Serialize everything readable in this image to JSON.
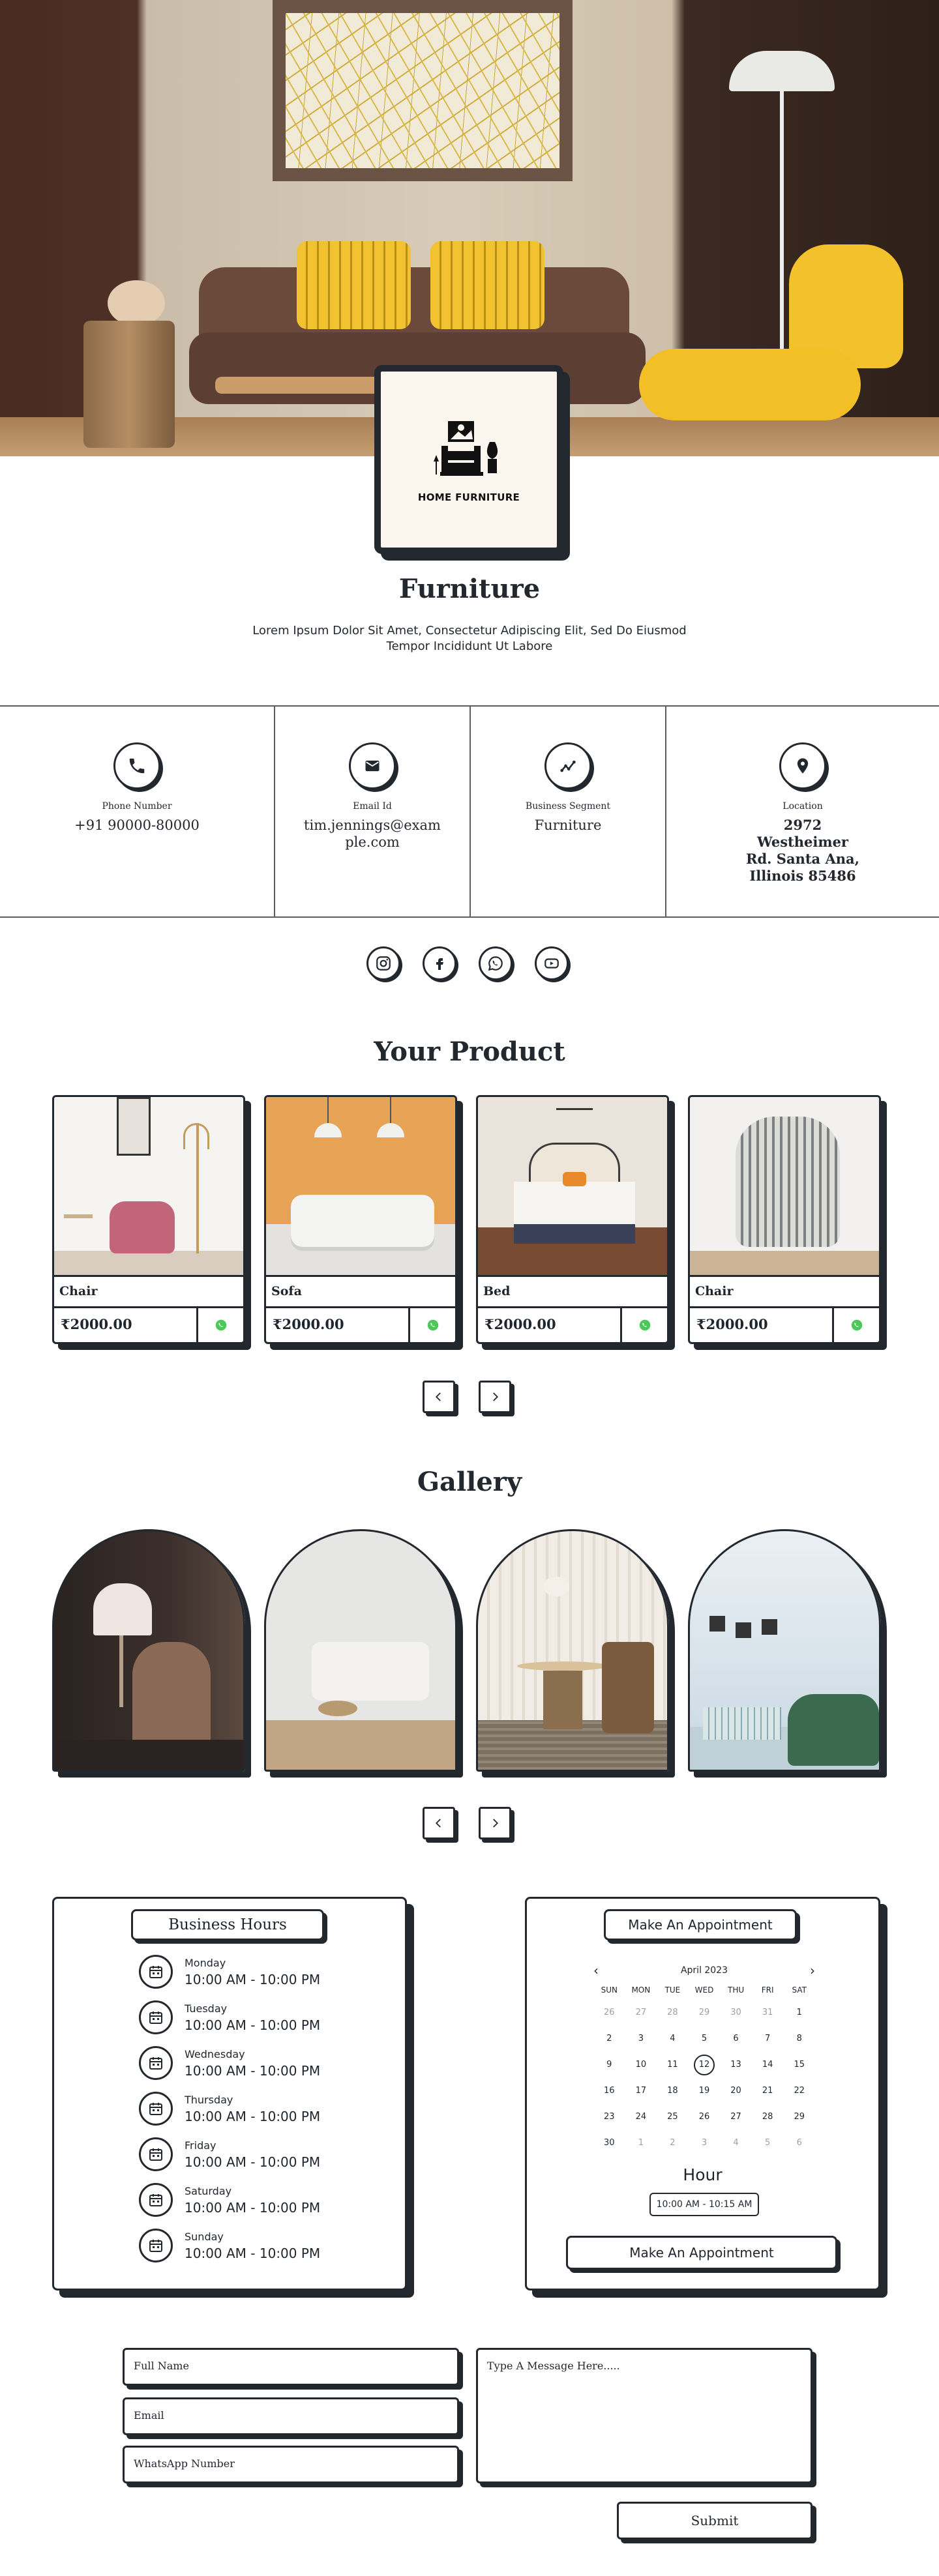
{
  "header": {
    "logo_text": "HOME FURNITURE",
    "business_name": "Furniture",
    "tagline": "Lorem Ipsum Dolor Sit Amet, Consectetur Adipiscing Elit, Sed Do Eiusmod Tempor Incididunt Ut Labore"
  },
  "contacts": [
    {
      "label": "Phone Number",
      "value": "+91 90000-80000",
      "icon": "phone-icon"
    },
    {
      "label": "Email Id",
      "value": "tim.jennings@example.com",
      "icon": "email-icon"
    },
    {
      "label": "Business Segment",
      "value": "Furniture",
      "icon": "segment-icon"
    },
    {
      "label": "Location",
      "value": "2972 Westheimer Rd. Santa Ana, Illinois 85486",
      "icon": "location-icon"
    }
  ],
  "socials": [
    "instagram-icon",
    "facebook-icon",
    "whatsapp-icon",
    "youtube-icon"
  ],
  "products": {
    "title": "Your Product",
    "items": [
      {
        "name": "Chair",
        "price": "₹2000.00"
      },
      {
        "name": "Sofa",
        "price": "₹2000.00"
      },
      {
        "name": "Bed",
        "price": "₹2000.00"
      },
      {
        "name": "Chair",
        "price": "₹2000.00"
      }
    ]
  },
  "gallery": {
    "title": "Gallery"
  },
  "hours": {
    "title": "Business Hours",
    "days": [
      {
        "day": "Monday",
        "time": "10:00 AM - 10:00 PM"
      },
      {
        "day": "Tuesday",
        "time": "10:00 AM - 10:00 PM"
      },
      {
        "day": "Wednesday",
        "time": "10:00 AM - 10:00 PM"
      },
      {
        "day": "Thursday",
        "time": "10:00 AM - 10:00 PM"
      },
      {
        "day": "Friday",
        "time": "10:00 AM - 10:00 PM"
      },
      {
        "day": "Saturday",
        "time": "10:00 AM - 10:00 PM"
      },
      {
        "day": "Sunday",
        "time": "10:00 AM - 10:00 PM"
      }
    ]
  },
  "appointment": {
    "title": "Make An Appointment",
    "month": "April 2023",
    "weekdays": [
      "SUN",
      "MON",
      "TUE",
      "WED",
      "THU",
      "FRI",
      "SAT"
    ],
    "selected_day": "12",
    "hour_label": "Hour",
    "hour_value": "10:00 AM - 10:15 AM",
    "button_label": "Make An Appointment"
  },
  "form": {
    "full_name_placeholder": "Full Name",
    "email_placeholder": "Email",
    "whatsapp_placeholder": "WhatsApp Number",
    "message_placeholder": "Type A Message Here.....",
    "submit_label": "Submit"
  }
}
